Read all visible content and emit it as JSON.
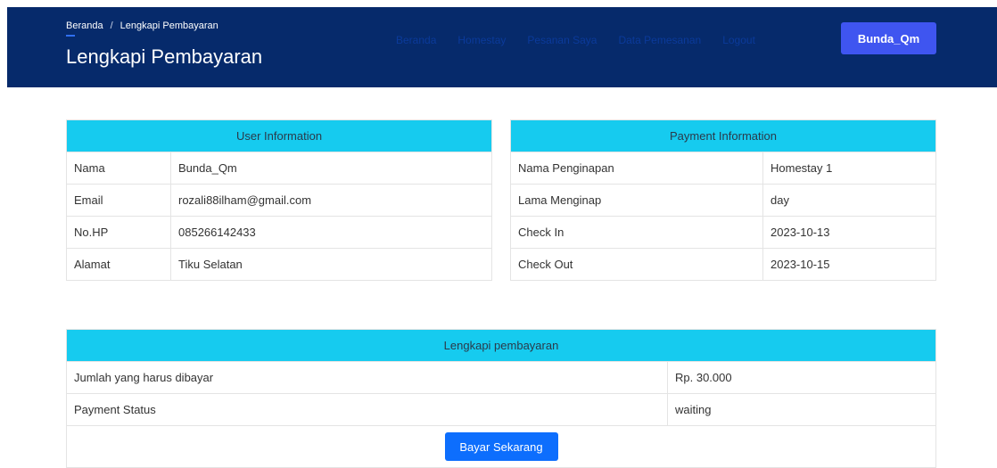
{
  "header": {
    "breadcrumb": [
      "Beranda",
      "Lengkapi Pembayaran"
    ],
    "title": "Lengkapi Pembayaran",
    "nav": [
      "Beranda",
      "Homestay",
      "Pesanan Saya",
      "Data Pemesanan",
      "Logout"
    ],
    "user_button": "Bunda_Qm"
  },
  "user_info": {
    "heading": "User Information",
    "rows": [
      {
        "label": "Nama",
        "value": "Bunda_Qm"
      },
      {
        "label": "Email",
        "value": "rozali88ilham@gmail.com"
      },
      {
        "label": "No.HP",
        "value": "085266142433"
      },
      {
        "label": "Alamat",
        "value": "Tiku Selatan"
      }
    ]
  },
  "payment_info": {
    "heading": "Payment Information",
    "rows": [
      {
        "label": "Nama Penginapan",
        "value": "Homestay 1"
      },
      {
        "label": "Lama Menginap",
        "value": "day"
      },
      {
        "label": "Check In",
        "value": "2023-10-13"
      },
      {
        "label": "Check Out",
        "value": "2023-10-15"
      }
    ]
  },
  "billing": {
    "heading": "Lengkapi pembayaran",
    "rows": [
      {
        "label": "Jumlah yang harus dibayar",
        "value": "Rp. 30.000"
      },
      {
        "label": "Payment Status",
        "value": "waiting"
      }
    ],
    "pay_button": "Bayar Sekarang"
  },
  "colors": {
    "header_bg": "#062a6b",
    "table_head": "#16cbef",
    "user_button": "#3f55f0",
    "pay_button": "#0d6efd"
  }
}
